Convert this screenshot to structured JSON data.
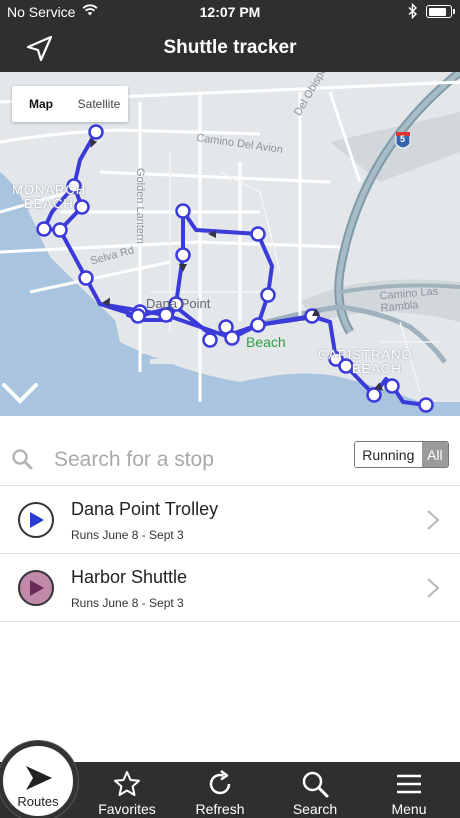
{
  "status_bar": {
    "carrier": "No Service",
    "time": "12:07 PM",
    "battery_level": 0.85
  },
  "nav": {
    "title": "Shuttle tracker",
    "locate_icon": "location-arrow-icon"
  },
  "map": {
    "map_type_options": [
      "Map",
      "Satellite"
    ],
    "selected_map_type": "Map",
    "labels": {
      "monarch_beach_1": "MONARCH",
      "monarch_beach_2": "BEACH",
      "dana_point": "Dana Point",
      "capistrano_beach_1": "CAPISTRANO",
      "capistrano_beach_2": "BEACH",
      "park_beach": "Beach",
      "camino_del_avion": "Camino Del Avion",
      "golden_lantern": "Golden Lantern",
      "del_obispo": "Del Obispo St",
      "camino_las_ramblas": "Camino Las Rambla",
      "selva_rd": "Selva Rd",
      "interstate": "5"
    },
    "route_color": "#3b3bd9"
  },
  "search": {
    "placeholder": "Search for a stop",
    "filter_options": [
      "Running",
      "All"
    ],
    "selected_filter": "All"
  },
  "routes": [
    {
      "name": "Dana Point Trolley",
      "schedule": "Runs June 8 - Sept 3",
      "badge_color": "#2a3bd4",
      "badge_bg": "#ffffff"
    },
    {
      "name": "Harbor Shuttle",
      "schedule": "Runs June 8 - Sept 3",
      "badge_color": "#6a2a5c",
      "badge_bg": "#c28aa8"
    }
  ],
  "tab_bar": {
    "routes": "Routes",
    "favorites": "Favorites",
    "refresh": "Refresh",
    "search": "Search",
    "menu": "Menu",
    "selected": "Routes"
  }
}
